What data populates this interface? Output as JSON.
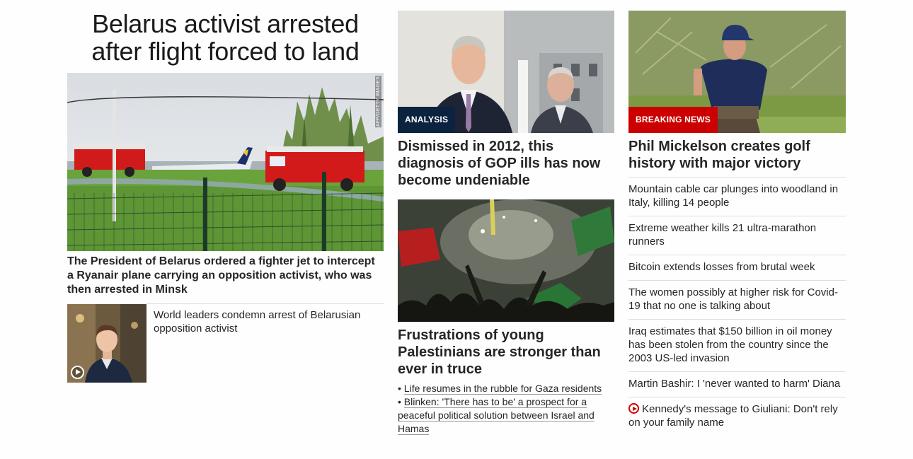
{
  "lead": {
    "headline": "Belarus activist arrested after flight forced to land",
    "photo_credit": "AFP/GETTY IMAGES",
    "caption": "The President of Belarus ordered a fighter jet to intercept a Ryanair plane carrying an opposition activist, who was then arrested in Minsk",
    "related": {
      "text": "World leaders condemn arrest of Belarusian opposition activist",
      "media_icon": "play-icon"
    }
  },
  "middle": {
    "story1": {
      "label": "ANALYSIS",
      "headline": "Dismissed in 2012, this diagnosis of GOP ills has now become undeniable"
    },
    "story2": {
      "headline": "Frustrations of young Palestinians are stronger than ever in truce",
      "bullets": [
        {
          "line1": "Life resumes in the rubble for Gaza residents"
        },
        {
          "line1": "Blinken: 'There has to be' a prospect for a",
          "line2": "peaceful political solution between Israel and",
          "line3": "Hamas"
        }
      ]
    }
  },
  "right": {
    "story": {
      "label": "BREAKING NEWS",
      "headline": "Phil Mickelson creates golf history with major victory"
    },
    "headlines": [
      "Mountain cable car plunges into woodland in Italy, killing 14 people",
      "Extreme weather kills 21 ultra-marathon runners",
      "Bitcoin extends losses from brutal week",
      "The women possibly at higher risk for Covid-19 that no one is talking about",
      "Iraq estimates that $150 billion in oil money has been stolen from the country since the 2003 US-led invasion",
      "Martin Bashir: I 'never wanted to harm' Diana",
      "Kennedy's message to Giuliani: Don't rely on your family name"
    ]
  },
  "colors": {
    "analysis_label": "#0c2340",
    "breaking_label": "#cc0000",
    "text": "#262626",
    "divider": "#dedede"
  }
}
